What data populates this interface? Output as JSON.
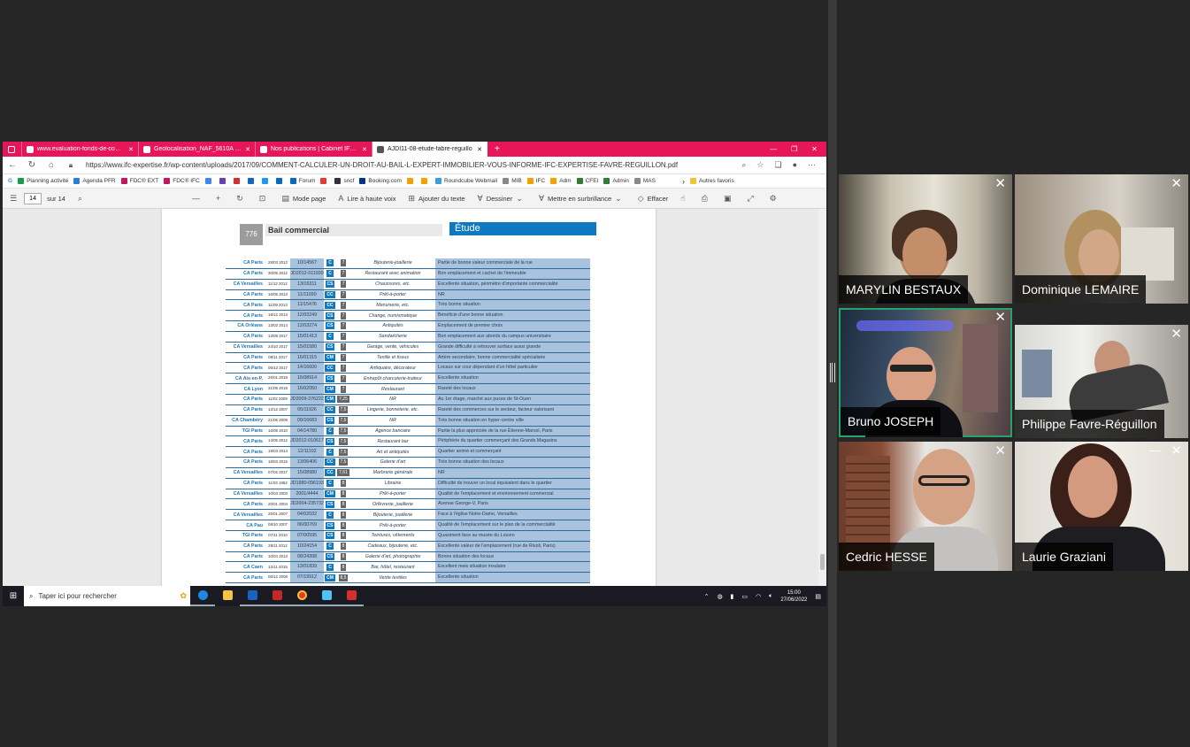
{
  "browser": {
    "tabs": [
      {
        "title": "www.evaluation-fonds-de-comm",
        "active": false
      },
      {
        "title": "Geolocalisation_NAF_5610A (20",
        "active": false
      },
      {
        "title": "Nos publications | Cabinet IFC E",
        "active": false
      },
      {
        "title": "AJDI11-08-etude-fabre-reguillo",
        "active": true
      }
    ],
    "url": "https://www.ifc-expertise.fr/wp-content/uploads/2017/09/COMMENT-CALCULER-UN-DROIT-AU-BAIL-L-EXPERT-IMMOBILIER-VOUS-INFORME-IFC-EXPERTISE-FAVRE-REGUILLON.pdf",
    "bookmarks": [
      "Planning activité",
      "Agenda PFR",
      "FDC® EXT",
      "FDC® IFC",
      "sncf",
      "Booking.com",
      "Roundcube Webmail",
      "MIB",
      "IFC",
      "Adm",
      "CFEI",
      "Admin",
      "MAS",
      "Forum"
    ],
    "other_favorites": "Autres favoris"
  },
  "pdf_toolbar": {
    "page": "14",
    "of_pages": "sur 14",
    "mode_page": "Mode page",
    "read_aloud": "Lire à haute voix",
    "add_text": "Ajouter du texte",
    "draw": "Dessiner",
    "highlight": "Mettre en surbrillance",
    "erase": "Effacer"
  },
  "document": {
    "page_number": "776",
    "title": "Bail commercial",
    "section": "Étude",
    "rows": [
      {
        "city": "CA Paris",
        "date": "28/03 2012",
        "ref": "10/14567",
        "type": "C",
        "dur": "7",
        "activity": "Bijouterie-joaillerie",
        "comment": "Partie de bonne valeur commerciale de la rue"
      },
      {
        "city": "CA Paris",
        "date": "30/05 2012",
        "ref": "JD2012-011999",
        "type": "C",
        "dur": "7",
        "activity": "Restaurant avec animation",
        "comment": "Bon emplacement et cachet de l'immeuble"
      },
      {
        "city": "CA Versailles",
        "date": "11/12 2012",
        "ref": "13/16311",
        "type": "CS",
        "dur": "7",
        "activity": "Chaussures, etc.",
        "comment": "Excellente situation, périmètre d'importante commercialité"
      },
      {
        "city": "CA Paris",
        "date": "16/05 2013",
        "ref": "11/11090",
        "type": "CC",
        "dur": "7",
        "activity": "Prêt-à-porter",
        "comment": "NR"
      },
      {
        "city": "CA Paris",
        "date": "11/09 2013",
        "ref": "11/15476",
        "type": "CC",
        "dur": "7",
        "activity": "Menuiserie, etc.",
        "comment": "Très bonne situation"
      },
      {
        "city": "CA Paris",
        "date": "18/12 2013",
        "ref": "12/03249",
        "type": "CS",
        "dur": "7",
        "activity": "Change, numismatique",
        "comment": "Bénéficie d'une bonne situation"
      },
      {
        "city": "CA Orléans",
        "date": "13/02 2014",
        "ref": "12/03274",
        "type": "CS",
        "dur": "7",
        "activity": "Antiquités",
        "comment": "Emplacement de premier choix"
      },
      {
        "city": "CA Paris",
        "date": "13/09 2017",
        "ref": "15/01413",
        "type": "C",
        "dur": "7",
        "activity": "Sandwicherie",
        "comment": "Bon emplacement aux abords du campus universitaire"
      },
      {
        "city": "CA Versailles",
        "date": "24/10 2017",
        "ref": "15/01580",
        "type": "CS",
        "dur": "7",
        "activity": "Garage, vente, véhicules",
        "comment": "Grande difficulté à retrouver surface aussi grande"
      },
      {
        "city": "CA Paris",
        "date": "08/11 2017",
        "ref": "16/01315",
        "type": "CM",
        "dur": "7",
        "activity": "Textile et tissus",
        "comment": "Artère secondaire, bonne commercialité spécialisée"
      },
      {
        "city": "CA Paris",
        "date": "06/12 2017",
        "ref": "14/16600",
        "type": "CC",
        "dur": "7",
        "activity": "Antiquaire, décorateur",
        "comment": "Locaux sur cour dépendant d'un hôtel particulier"
      },
      {
        "city": "CA Aix-en-P.",
        "date": "25/01 2018",
        "ref": "16/08914",
        "type": "CS",
        "dur": "7",
        "activity": "Entrepôt charcuterie-traiteur",
        "comment": "Excellente situation"
      },
      {
        "city": "CA Lyon",
        "date": "31/05 2018",
        "ref": "16/02050",
        "type": "CM",
        "dur": "7",
        "activity": "Restaurant",
        "comment": "Rareté des locaux"
      },
      {
        "city": "CA Paris",
        "date": "11/02 2009",
        "ref": "JD2009-376222",
        "type": "CM",
        "dur": "7,25",
        "activity": "NR",
        "comment": "Au 1er étage, marché aux puces de St-Ouen"
      },
      {
        "city": "CA Paris",
        "date": "12/12 2007",
        "ref": "05/11926",
        "type": "CC",
        "dur": "7,5",
        "activity": "Lingerie, bonneterie, etc.",
        "comment": "Rareté des commerces sur le secteur, facteur valorisant"
      },
      {
        "city": "CA Chambéry",
        "date": "21/06 2009",
        "ref": "09/16683",
        "type": "CS",
        "dur": "7,5",
        "activity": "NR",
        "comment": "Très bonne situation en hyper-centre ville"
      },
      {
        "city": "TGI Paris",
        "date": "16/09 2010",
        "ref": "04/14780",
        "type": "C",
        "dur": "7,5",
        "activity": "Agence bancaire",
        "comment": "Partie la plus appréciée de la rue Étienne-Marcel, Paris"
      },
      {
        "city": "CA Paris",
        "date": "14/05 2012",
        "ref": "JD2012-010617",
        "type": "CS",
        "dur": "7,5",
        "activity": "Restaurant bar",
        "comment": "Périphérie du quartier commerçant des Grands Magasins"
      },
      {
        "city": "CA Paris",
        "date": "19/03 2014",
        "ref": "12/11102",
        "type": "C",
        "dur": "7,5",
        "activity": "Art et antiquités",
        "comment": "Quartier animé et commerçant"
      },
      {
        "city": "CA Paris",
        "date": "18/03 2015",
        "ref": "13/06406",
        "type": "CC",
        "dur": "7,5",
        "activity": "Galerie d'art",
        "comment": "Très bonne situation des locaux"
      },
      {
        "city": "CA Versailles",
        "date": "07/02 2017",
        "ref": "15/08980",
        "type": "CC",
        "dur": "7,61",
        "activity": "Marbrerie générale",
        "comment": "NR"
      },
      {
        "city": "CA Paris",
        "date": "11/03 1982",
        "ref": "JD1980-096193",
        "type": "C",
        "dur": "8",
        "activity": "Librairie",
        "comment": "Difficulté de trouver un local équivalent dans le quartier"
      },
      {
        "city": "CA Versailles",
        "date": "10/03 2003",
        "ref": "2001/4444",
        "type": "CM",
        "dur": "8",
        "activity": "Prêt-à-porter",
        "comment": "Qualité de l'emplacement et environnement commercial"
      },
      {
        "city": "CA Paris",
        "date": "20/01 2004",
        "ref": "JD2004-235732",
        "type": "CS",
        "dur": "8",
        "activity": "Orfèvrerie, joaillerie",
        "comment": "Avenue George-V, Paris"
      },
      {
        "city": "CA Versailles",
        "date": "25/01 2007",
        "ref": "04/02032",
        "type": "C",
        "dur": "8",
        "activity": "Bijouterie, joaillerie",
        "comment": "Face à l'église Notre-Dame, Versailles"
      },
      {
        "city": "CA Pau",
        "date": "08/10 2007",
        "ref": "06/00769",
        "type": "CS",
        "dur": "8",
        "activity": "Prêt-à-porter",
        "comment": "Qualité de l'emplacement sur le plan de la commercialité"
      },
      {
        "city": "TGI Paris",
        "date": "07/11 2010",
        "ref": "07/00595",
        "type": "CS",
        "dur": "8",
        "activity": "Teintures, vêtements",
        "comment": "Quasiment face au musée du Louvre"
      },
      {
        "city": "CA Paris",
        "date": "28/11 2012",
        "ref": "10/24154",
        "type": "C",
        "dur": "8",
        "activity": "Cadeaux, bijouterie, etc.",
        "comment": "Excellente valeur de l'emplacement (rue de Rivoli, Paris)"
      },
      {
        "city": "CA Paris",
        "date": "10/04 2013",
        "ref": "08/24398",
        "type": "CS",
        "dur": "8",
        "activity": "Galerie d'art, photographie",
        "comment": "Bonne situation des locaux"
      },
      {
        "city": "CA Caen",
        "date": "12/11 2015",
        "ref": "13/01839",
        "type": "C",
        "dur": "8",
        "activity": "Bar, hôtel, restaurant",
        "comment": "Excellent mais situation insulaire"
      },
      {
        "city": "CA Paris",
        "date": "05/12 2008",
        "ref": "07/19912",
        "type": "CM",
        "dur": "8,5",
        "activity": "Vente textiles",
        "comment": "Excellente situation"
      }
    ]
  },
  "taskbar": {
    "search_placeholder": "Taper ici pour rechercher",
    "time": "15:00",
    "date": "27/06/2022"
  },
  "participants": [
    {
      "name": "MARYLIN BESTAUX",
      "speaking": false
    },
    {
      "name": "Dominique LEMAIRE",
      "speaking": false
    },
    {
      "name": "Bruno JOSEPH",
      "speaking": true
    },
    {
      "name": "Philippe Favre-Réguillon",
      "speaking": false
    },
    {
      "name": "Cedric HESSE",
      "speaking": false
    },
    {
      "name": "Laurie Graziani",
      "speaking": false
    }
  ],
  "colors": {
    "tabbar": "#e7165b",
    "accent_blue": "#0e79c1",
    "table_fill": "#a9c3de",
    "speaking_border": "#25a36b",
    "background": "#262626"
  }
}
